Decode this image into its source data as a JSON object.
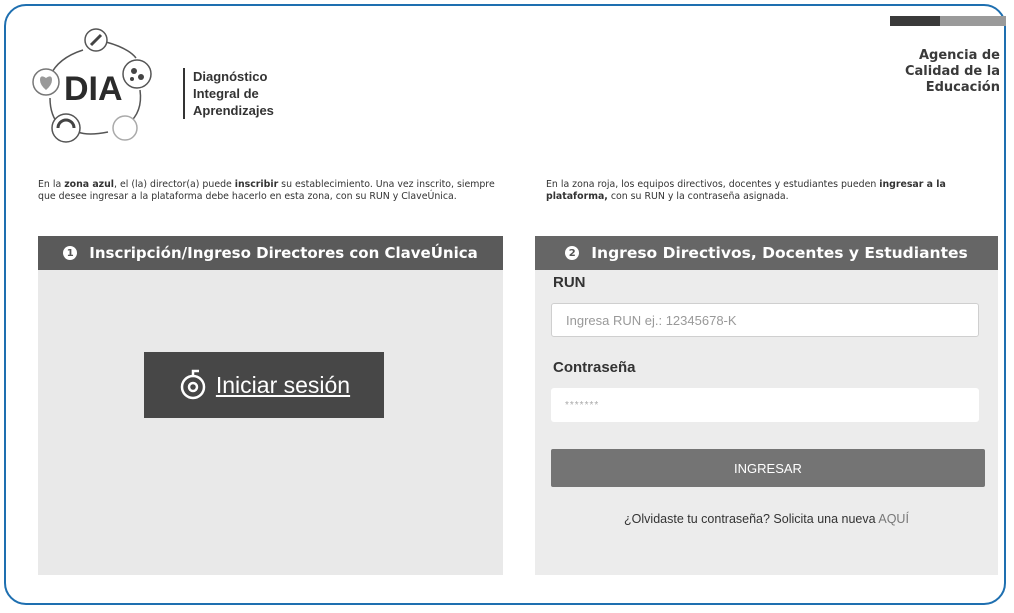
{
  "logo": {
    "acronym": "DIA",
    "lines": [
      "Diagnóstico",
      "Integral de",
      "Aprendizajes"
    ]
  },
  "agency": {
    "lines": [
      "Agencia de",
      "Calidad de la",
      "Educación"
    ]
  },
  "intro_left": {
    "t1": "En la ",
    "b1": "zona azul",
    "t2": ", el (la) director(a) puede ",
    "b2": "inscribir",
    "t3": " su establecimiento. Una vez inscrito, siempre que desee ingresar a la plataforma debe hacerlo en esta zona, con su RUN y ClaveÚnica."
  },
  "intro_right": {
    "t1": "En la zona roja, los equipos directivos, docentes y estudiantes pueden ",
    "b1": "ingresar a la plataforma,",
    "t2": " con su RUN y la contraseña asignada."
  },
  "panel_left": {
    "number": "1",
    "title": "Inscripción/Ingreso Directores con ClaveÚnica",
    "login_label": "Iniciar sesión"
  },
  "panel_right": {
    "number": "2",
    "title": "Ingreso Directivos, Docentes y Estudiantes",
    "run_label": "RUN",
    "run_placeholder": "Ingresa RUN ej.: 12345678-K",
    "password_label": "Contraseña",
    "password_value": "*******",
    "submit_label": "INGRESAR",
    "forgot_text": "¿Olvidaste tu contraseña? Solicita una nueva ",
    "forgot_link": "AQUÍ"
  },
  "colors": {
    "frame": "#1e6fb0",
    "panel_header": "#5a5a5a",
    "login_button": "#474747",
    "submit_button": "#747474"
  }
}
